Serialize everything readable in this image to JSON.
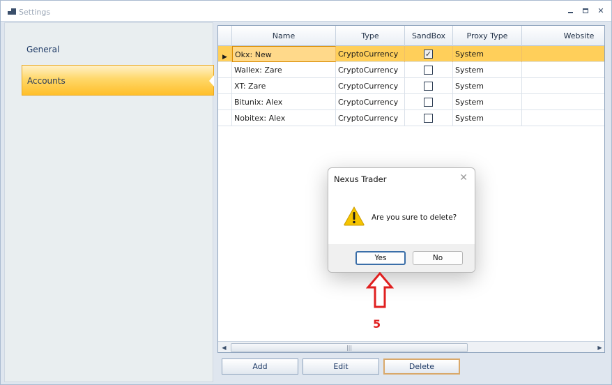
{
  "window": {
    "title": "Settings"
  },
  "nav": {
    "items": [
      {
        "label": "General",
        "selected": false
      },
      {
        "label": "Accounts",
        "selected": true
      }
    ]
  },
  "grid": {
    "columns": [
      "Name",
      "Type",
      "SandBox",
      "Proxy Type",
      "Website"
    ],
    "rows": [
      {
        "name": "Okx: New",
        "type": "CryptoCurrency",
        "sandbox": true,
        "proxy_type": "System",
        "website": "",
        "selected": true
      },
      {
        "name": "Wallex: Zare",
        "type": "CryptoCurrency",
        "sandbox": false,
        "proxy_type": "System",
        "website": ""
      },
      {
        "name": "XT: Zare",
        "type": "CryptoCurrency",
        "sandbox": false,
        "proxy_type": "System",
        "website": ""
      },
      {
        "name": "Bitunix: Alex",
        "type": "CryptoCurrency",
        "sandbox": false,
        "proxy_type": "System",
        "website": ""
      },
      {
        "name": "Nobitex: Alex",
        "type": "CryptoCurrency",
        "sandbox": false,
        "proxy_type": "System",
        "website": ""
      }
    ]
  },
  "actions": {
    "add_label": "Add",
    "edit_label": "Edit",
    "delete_label": "Delete"
  },
  "dialog": {
    "title": "Nexus Trader",
    "message": "Are you sure to delete?",
    "yes_label": "Yes",
    "no_label": "No",
    "icon": "warning-icon"
  },
  "annotation": {
    "step_number": "5",
    "color": "#e02020"
  },
  "colors": {
    "selection": "#ffcf5a",
    "accent": "#ffbf2a",
    "header_text": "#1e3a66"
  }
}
